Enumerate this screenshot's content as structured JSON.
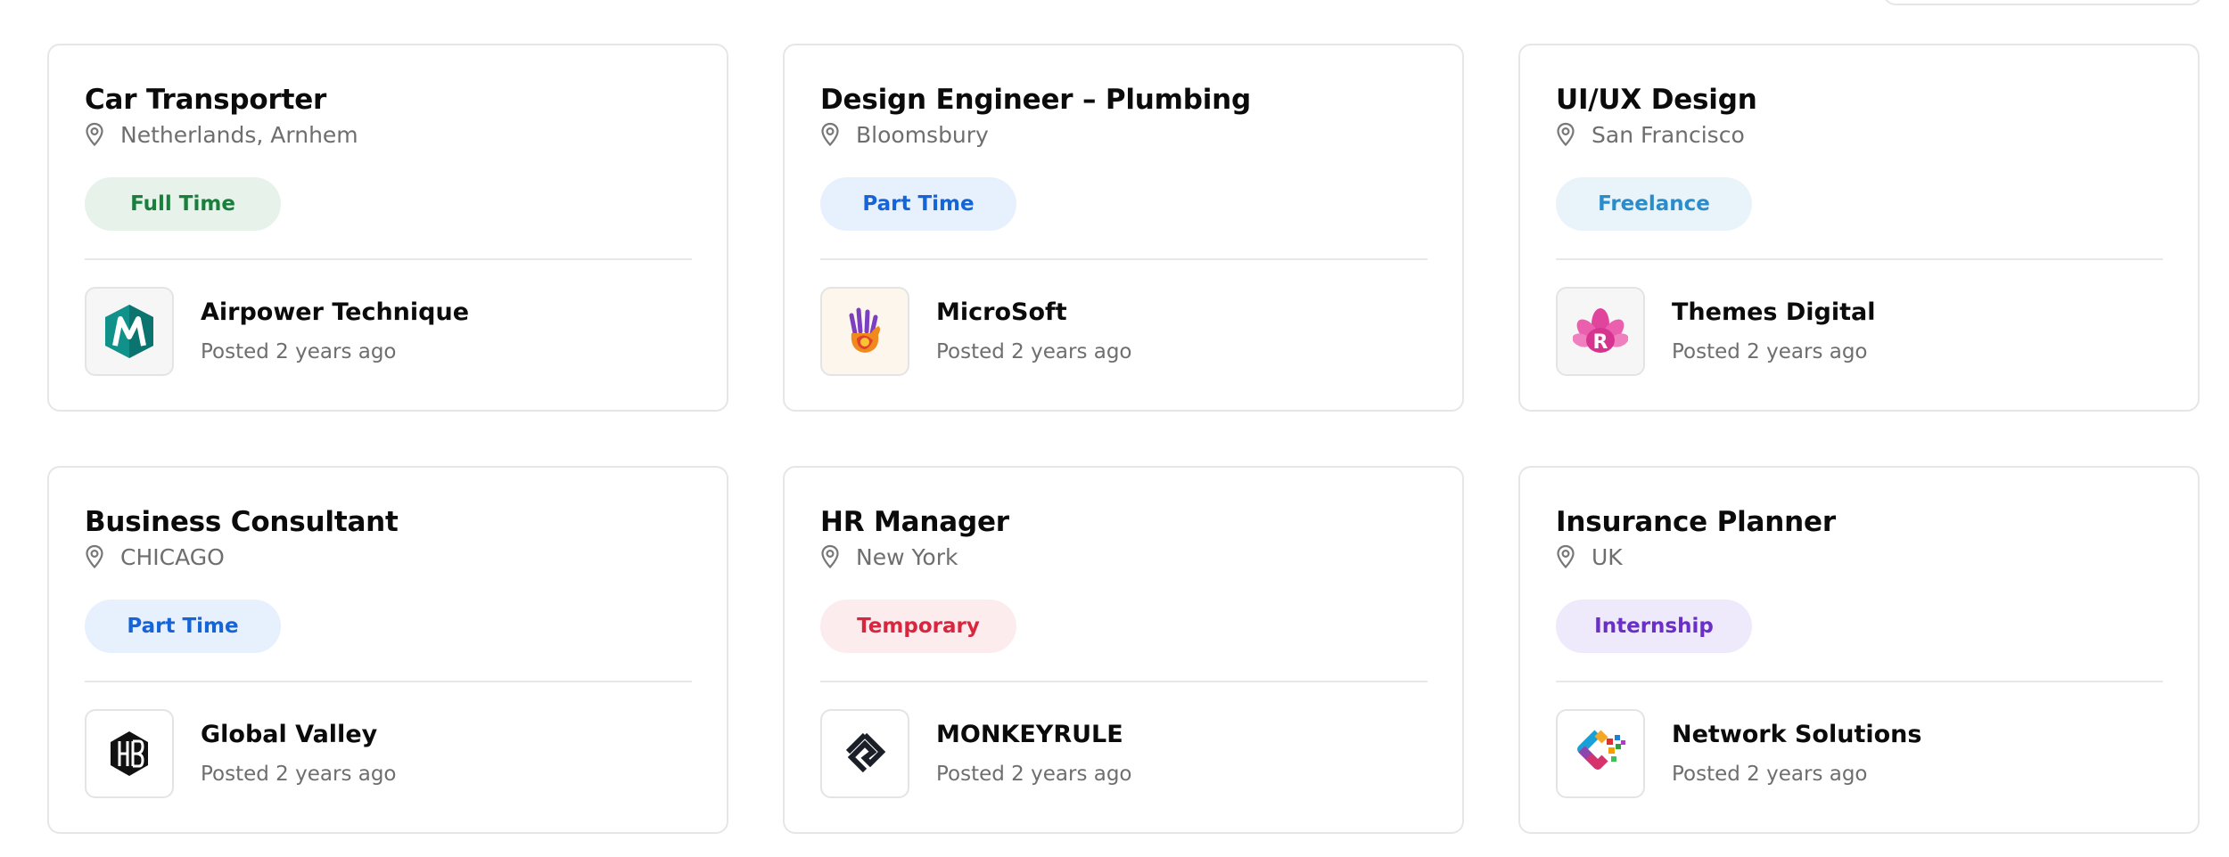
{
  "jobs": [
    {
      "title": "Car Transporter",
      "location": "Netherlands, Arnhem",
      "type": "Full Time",
      "badge_bg": "#e7f2eb",
      "badge_color": "#1a7f3c",
      "company": "Airpower Technique",
      "posted": "Posted 2 years ago",
      "logo_icon": "teal-m-hexagon-logo"
    },
    {
      "title": "Design Engineer – Plumbing",
      "location": "Bloomsbury",
      "type": "Part Time",
      "badge_bg": "#e7f0fd",
      "badge_color": "#1565d8",
      "company": "MicroSoft",
      "posted": "Posted 2 years ago",
      "logo_icon": "colorful-hand-logo"
    },
    {
      "title": "UI/UX Design",
      "location": "San Francisco",
      "type": "Freelance",
      "badge_bg": "#e9f3fa",
      "badge_color": "#2b8ccb",
      "company": "Themes Digital",
      "posted": "Posted 2 years ago",
      "logo_icon": "pink-lotus-r-logo"
    },
    {
      "title": "Business Consultant",
      "location": "CHICAGO",
      "type": "Part Time",
      "badge_bg": "#e7f0fd",
      "badge_color": "#1565d8",
      "company": "Global Valley",
      "posted": "Posted 2 years ago",
      "logo_icon": "hexagon-hb-logo"
    },
    {
      "title": "HR Manager",
      "location": "New York",
      "type": "Temporary",
      "badge_bg": "#fdecee",
      "badge_color": "#d7263d",
      "company": "MONKEYRULE",
      "posted": "Posted 2 years ago",
      "logo_icon": "diamond-s-logo"
    },
    {
      "title": "Insurance Planner",
      "location": "UK",
      "type": "Internship",
      "badge_bg": "#efeafb",
      "badge_color": "#6a2fc4",
      "company": "Network Solutions",
      "posted": "Posted 2 years ago",
      "logo_icon": "multicolor-c-pixel-logo"
    }
  ]
}
